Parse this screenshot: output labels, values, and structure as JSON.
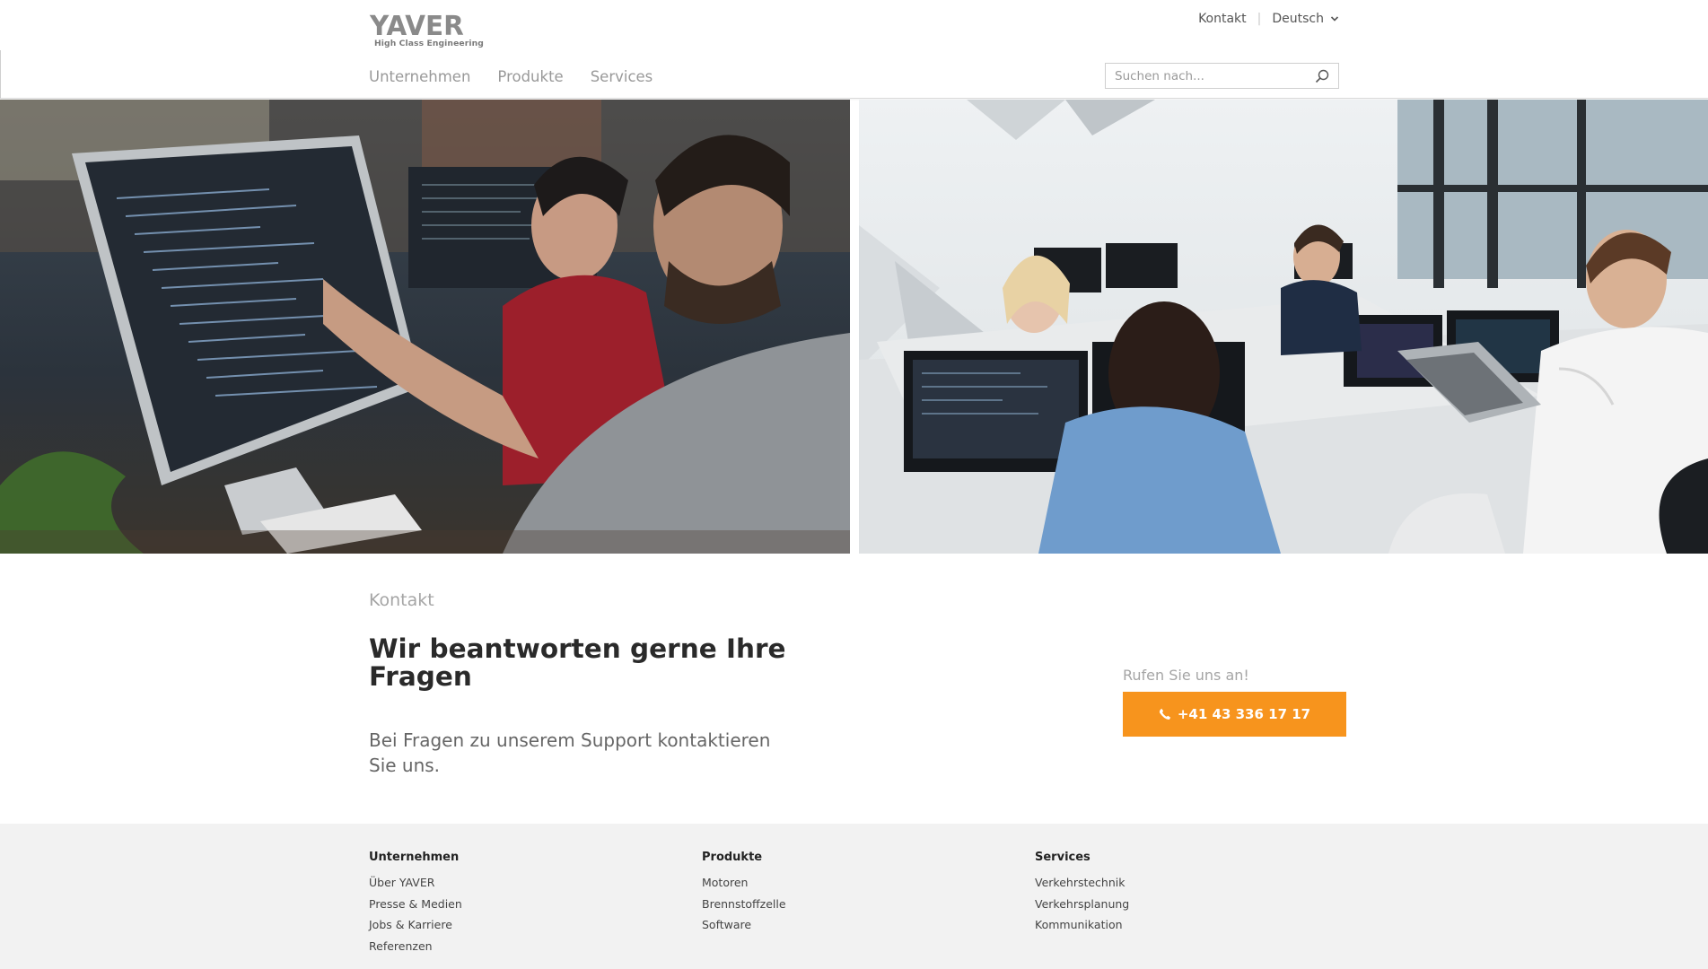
{
  "brand": {
    "name": "YAVER",
    "tagline": "High Class Engineering"
  },
  "topnav": {
    "contact": "Kontakt",
    "language": "Deutsch"
  },
  "mainnav": [
    {
      "label": "Unternehmen"
    },
    {
      "label": "Produkte"
    },
    {
      "label": "Services"
    }
  ],
  "search": {
    "placeholder": "Suchen nach..."
  },
  "contact": {
    "eyebrow": "Kontakt",
    "headline": "Wir beantworten gerne Ihre Fragen",
    "lead": "Bei Fragen zu unserem Support kontaktieren Sie uns.",
    "call_hint": "Rufen Sie uns an!",
    "phone": "+41 43 336 17 17"
  },
  "footer": {
    "columns": [
      {
        "title": "Unternehmen",
        "links": [
          "Über YAVER",
          "Presse & Medien",
          "Jobs & Karriere",
          "Referenzen"
        ]
      },
      {
        "title": "Produkte",
        "links": [
          "Motoren",
          "Brennstoffzelle",
          "Software"
        ]
      },
      {
        "title": "Services",
        "links": [
          "Verkehrstechnik",
          "Verkehrsplanung",
          "Kommunikation"
        ]
      }
    ]
  },
  "colors": {
    "accent": "#f7941d",
    "footer_bg": "#f2f2f2",
    "muted_text": "#999999"
  },
  "icons": [
    "search-icon",
    "chevron-down-icon",
    "phone-icon"
  ]
}
